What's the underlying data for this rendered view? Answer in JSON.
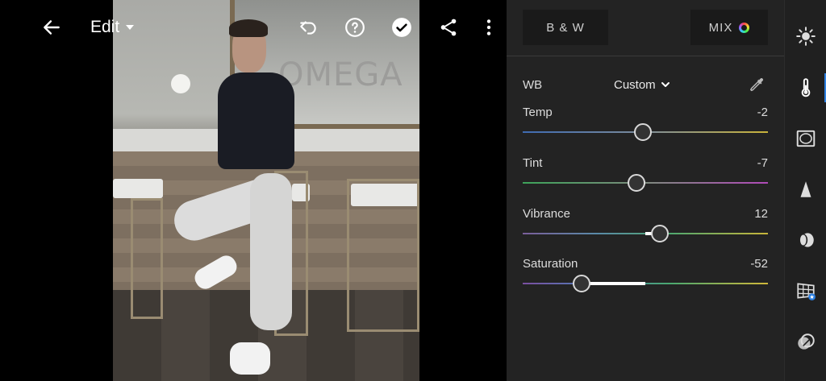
{
  "topbar": {
    "back_icon": "arrow-left-icon",
    "edit_label": "Edit",
    "undo_icon": "undo-icon",
    "help_icon": "help-circle-icon",
    "done_icon": "checkmark-circle-icon",
    "share_icon": "share-icon",
    "more_icon": "more-vertical-icon"
  },
  "photo": {
    "sign_text": "OMEGA"
  },
  "panel": {
    "tabs": {
      "bw_label": "B & W",
      "mix_label": "MIX"
    },
    "wb": {
      "label": "WB",
      "value": "Custom",
      "eyedropper_icon": "eyedropper-icon"
    },
    "sliders": [
      {
        "label": "Temp",
        "value": "-2",
        "min": -100,
        "max": 100,
        "current": -2
      },
      {
        "label": "Tint",
        "value": "-7",
        "min": -100,
        "max": 100,
        "current": -7
      },
      {
        "label": "Vibrance",
        "value": "12",
        "min": -100,
        "max": 100,
        "current": 12
      },
      {
        "label": "Saturation",
        "value": "-52",
        "min": -100,
        "max": 100,
        "current": -52
      }
    ]
  },
  "toolstrip": {
    "items": [
      {
        "icon": "light-icon",
        "active": false
      },
      {
        "icon": "color-thermometer-icon",
        "active": true
      },
      {
        "icon": "effects-vignette-icon",
        "active": false
      },
      {
        "icon": "detail-triangle-icon",
        "active": false
      },
      {
        "icon": "optics-lens-icon",
        "active": false
      },
      {
        "icon": "geometry-grid-icon",
        "active": false
      },
      {
        "icon": "presets-icon",
        "active": false
      }
    ]
  },
  "colors": {
    "panel_bg": "#232323",
    "accent": "#2d7fe0"
  }
}
